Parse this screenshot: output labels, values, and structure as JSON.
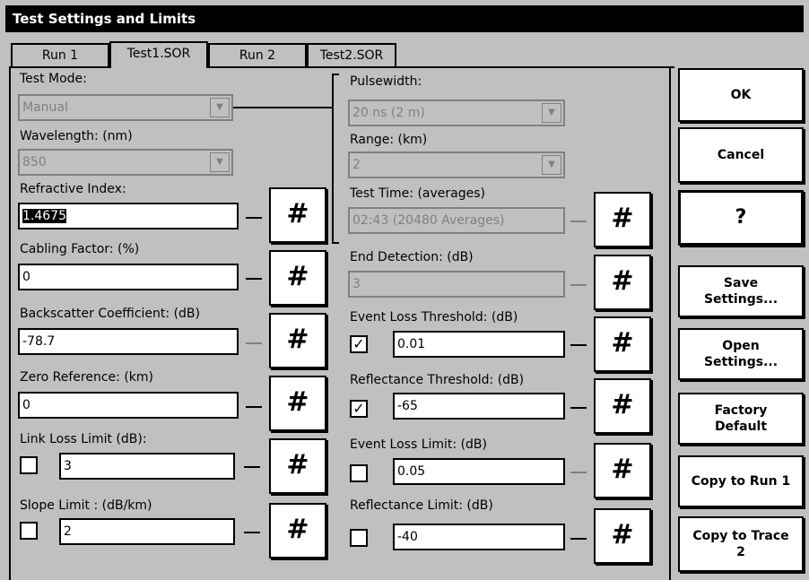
{
  "window": {
    "title": "Test Settings and Limits"
  },
  "tabs": [
    {
      "label": "Run 1"
    },
    {
      "label": "Test1.SOR"
    },
    {
      "label": "Run 2"
    },
    {
      "label": "Test2.SOR"
    }
  ],
  "left": {
    "test_mode": {
      "label": "Test Mode:",
      "value": "Manual"
    },
    "wavelength": {
      "label": "Wavelength: (nm)",
      "value": "850"
    },
    "refractive_index": {
      "label": "Refractive Index:",
      "value": "1.4675"
    },
    "cabling_factor": {
      "label": "Cabling Factor: (%)",
      "value": "0"
    },
    "backscatter": {
      "label": "Backscatter Coefficient: (dB)",
      "value": "-78.7"
    },
    "zero_reference": {
      "label": "Zero Reference: (km)",
      "value": "0"
    },
    "link_loss_limit": {
      "label": "Link Loss Limit (dB):",
      "value": "3",
      "checked": false
    },
    "slope_limit": {
      "label": "Slope Limit : (dB/km)",
      "value": "2",
      "checked": false
    }
  },
  "right": {
    "pulsewidth": {
      "label": "Pulsewidth:",
      "value": "20 ns (2 m)"
    },
    "range": {
      "label": "Range: (km)",
      "value": "2"
    },
    "test_time": {
      "label": "Test Time: (averages)",
      "value": "02:43 (20480 Averages)"
    },
    "end_detection": {
      "label": "End Detection: (dB)",
      "value": "3"
    },
    "event_loss_threshold": {
      "label": "Event Loss Threshold: (dB)",
      "value": "0.01",
      "checked": true
    },
    "reflectance_threshold": {
      "label": "Reflectance Threshold: (dB)",
      "value": "-65",
      "checked": true
    },
    "event_loss_limit": {
      "label": "Event Loss Limit: (dB)",
      "value": "0.05",
      "checked": false
    },
    "reflectance_limit": {
      "label": "Reflectance Limit: (dB)",
      "value": "-40",
      "checked": false
    }
  },
  "keypad_symbol": "#",
  "check_mark": "✓",
  "dropdown_arrow": "▼",
  "sidebar": {
    "ok": "OK",
    "cancel": "Cancel",
    "help": "?",
    "save_settings": "Save Settings...",
    "open_settings": "Open Settings...",
    "factory_default": "Factory Default",
    "copy_to_run": "Copy to Run 1",
    "copy_to_trace": "Copy to Trace 2"
  }
}
